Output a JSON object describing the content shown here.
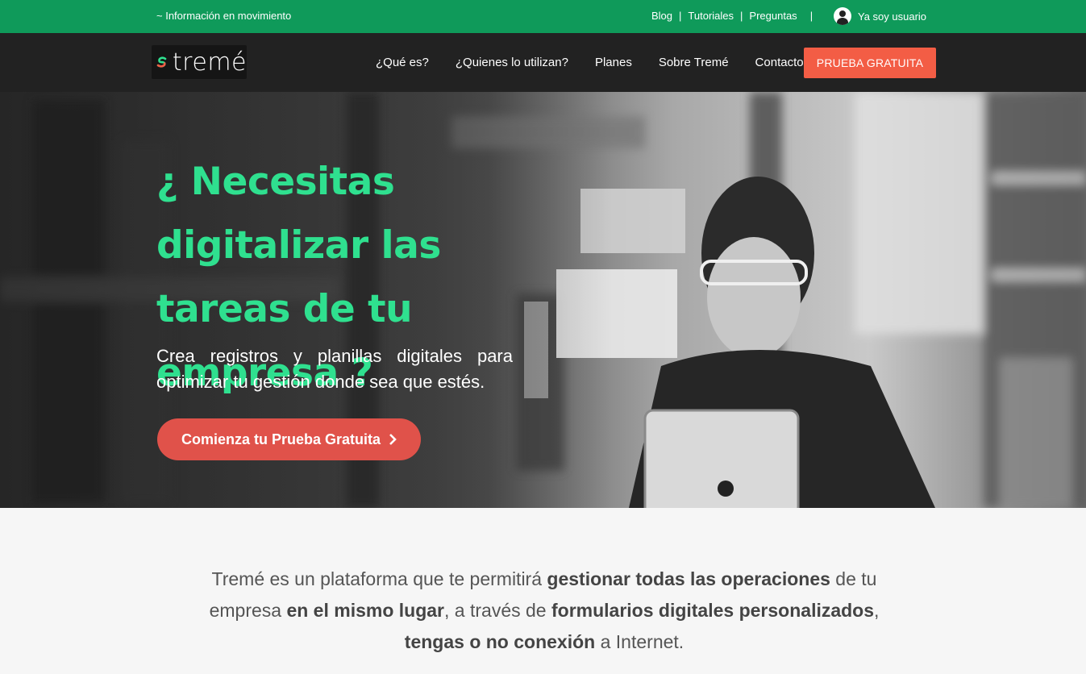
{
  "topbar": {
    "tagline": "~ Información en movimiento",
    "links": [
      "Blog",
      "Tutoriales",
      "Preguntas"
    ],
    "user_label": "Ya soy usuario"
  },
  "nav": {
    "logo_text": "tremé",
    "menu": [
      "¿Qué es?",
      "¿Quienes lo utilizan?",
      "Planes",
      "Sobre Tremé",
      "Contacto"
    ],
    "cta": "PRUEBA GRATUITA"
  },
  "hero": {
    "title": "¿ Necesitas digitalizar las tareas de tu empresa ?",
    "subtitle": "Crea registros y planillas digitales para optimizar tu gestión donde sea que estés.",
    "cta": "Comienza tu Prueba Gratuita"
  },
  "intro": {
    "p1": "Tremé es un plataforma que te permitirá ",
    "b1": "gestionar todas las operaciones",
    "p2": " de tu empresa ",
    "b2": "en el mismo lugar",
    "p3": ", a través de ",
    "b3": "formularios digitales personalizados",
    "p4": ", ",
    "b4": "tengas o no conexión",
    "p5": " a Internet."
  },
  "colors": {
    "topbar": "#0f9a5a",
    "nav": "#222222",
    "accent_green": "#2fe08f",
    "cta_orange": "#f35d45",
    "cta_red": "#e0524a"
  }
}
